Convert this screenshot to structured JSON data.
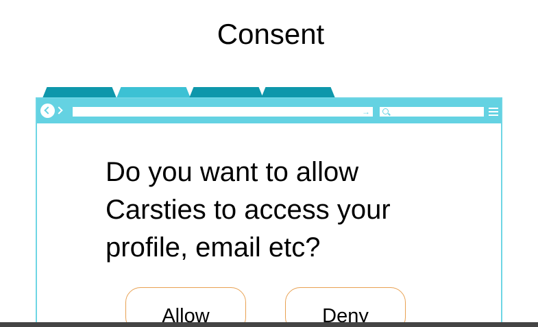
{
  "page": {
    "title": "Consent"
  },
  "browser": {
    "tabs": [
      "",
      "",
      "",
      ""
    ],
    "go_icon": "→"
  },
  "consent": {
    "question": "Do you want to allow Carsties to access your profile, email etc?",
    "allow_label": "Allow",
    "deny_label": "Deny"
  },
  "colors": {
    "toolbar": "#64d2e2",
    "tab_dark": "#0e97ab",
    "tab_light": "#3cc1d4",
    "button_border": "#e8a050"
  },
  "icons": {
    "back": "back-arrow-icon",
    "forward": "forward-arrow-icon",
    "go": "arrow-right-icon",
    "search": "search-icon",
    "menu": "hamburger-menu-icon"
  }
}
